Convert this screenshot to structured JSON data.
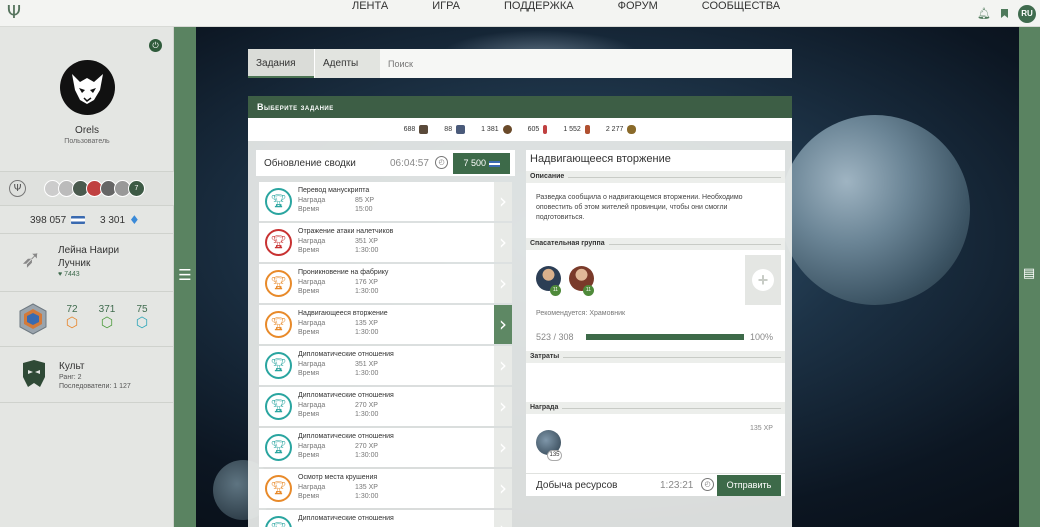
{
  "nav": {
    "items": [
      "ЛЕНТА",
      "ИГРА",
      "ПОДДЕРЖКА",
      "ФОРУМ",
      "СООБЩЕСТВА"
    ],
    "lang": "RU"
  },
  "profile": {
    "name": "Orels",
    "role": "Пользователь",
    "followers_extra": "7",
    "gold": "398 057",
    "crystals": "3 301"
  },
  "character": {
    "name": "Лейна Наири",
    "class": "Лучник",
    "value": "7443"
  },
  "stats": [
    {
      "value": "72",
      "color": "#e8852a"
    },
    {
      "value": "371",
      "color": "#4a9a3a"
    },
    {
      "value": "75",
      "color": "#2aa5b8"
    }
  ],
  "cult": {
    "name": "Культ",
    "rank": "Ранг: 2",
    "followers": "Последователи: 1 127"
  },
  "tabs": {
    "quests": "Задания",
    "adepts": "Адепты",
    "search_placeholder": "Поиск"
  },
  "panel_title": "Выберите задание",
  "resources": [
    {
      "value": "688",
      "color": "#5a4a3a"
    },
    {
      "value": "88",
      "color": "#4a5a7a"
    },
    {
      "value": "1 381",
      "color": "#6a4a2a"
    },
    {
      "value": "605",
      "color": "#c04040"
    },
    {
      "value": "1 552",
      "color": "#b05030"
    },
    {
      "value": "2 277",
      "color": "#8a6a2a"
    }
  ],
  "summary": {
    "label": "Обновление сводки",
    "time": "06:04:57",
    "button": "7 500"
  },
  "quest_labels": {
    "reward": "Награда",
    "time": "Время"
  },
  "quests": [
    {
      "title": "Перевод манускрипта",
      "reward": "85 XP",
      "time": "15:00",
      "color": "#2aa5a0"
    },
    {
      "title": "Отражение атаки налетчиков",
      "reward": "351 XP",
      "time": "1:30:00",
      "color": "#c83232"
    },
    {
      "title": "Проникновение на фабрику",
      "reward": "176 XP",
      "time": "1:30:00",
      "color": "#e88a2a"
    },
    {
      "title": "Надвигающееся вторжение",
      "reward": "135 XP",
      "time": "1:30:00",
      "color": "#e88a2a"
    },
    {
      "title": "Дипломатические отношения",
      "reward": "351 XP",
      "time": "1:30:00",
      "color": "#2aa5a0"
    },
    {
      "title": "Дипломатические отношения",
      "reward": "270 XP",
      "time": "1:30:00",
      "color": "#2aa5a0"
    },
    {
      "title": "Дипломатические отношения",
      "reward": "270 XP",
      "time": "1:30:00",
      "color": "#2aa5a0"
    },
    {
      "title": "Осмотр места крушения",
      "reward": "135 XP",
      "time": "1:30:00",
      "color": "#e88a2a"
    },
    {
      "title": "Дипломатические отношения",
      "reward": "",
      "time": "",
      "color": "#2aa5a0"
    }
  ],
  "detail": {
    "title": "Надвигающееся вторжение",
    "desc_label": "Описание",
    "description": "Разведка сообщила о надвигающемся вторжении. Необходимо оповестить об этом жителей провинции, чтобы они смогли подготовиться.",
    "rescue_label": "Спасательная группа",
    "heroes": [
      {
        "level": "11"
      },
      {
        "level": "11"
      }
    ],
    "recommended": "Рекомендуется: Храмовник",
    "progress_text": "523 / 308",
    "progress_pct": "100%",
    "progress_fraction": 1.0,
    "costs_label": "Затраты",
    "reward_label": "Награда",
    "reward_count": "135",
    "reward_xp": "135 XP",
    "footer_label": "Добыча ресурсов",
    "footer_time": "1:23:21",
    "send": "Отправить"
  }
}
